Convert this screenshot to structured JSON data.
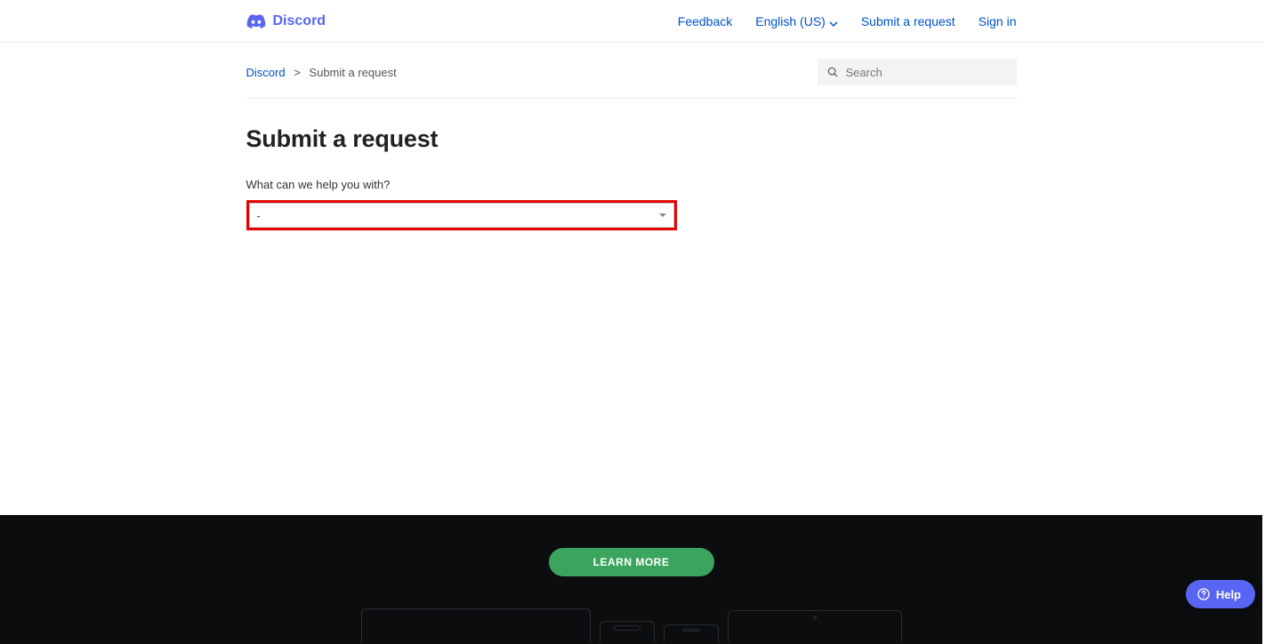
{
  "brand": {
    "name": "Discord"
  },
  "nav": {
    "feedback": "Feedback",
    "language": "English (US)",
    "submit": "Submit a request",
    "signin": "Sign in"
  },
  "breadcrumb": {
    "root": "Discord",
    "sep": ">",
    "current": "Submit a request"
  },
  "search": {
    "placeholder": "Search"
  },
  "page": {
    "title": "Submit a request",
    "field_label": "What can we help you with?",
    "select_value": "-"
  },
  "footer": {
    "learn_more": "LEARN MORE"
  },
  "help": {
    "label": "Help"
  }
}
